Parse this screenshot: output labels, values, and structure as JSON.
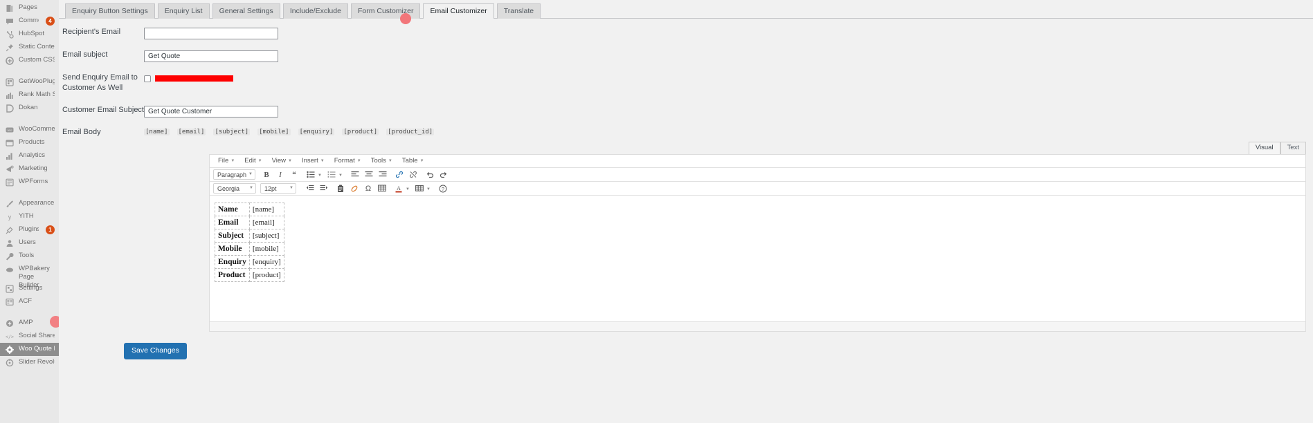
{
  "sidebar": {
    "items": [
      {
        "label": "Pages",
        "icon": "pages-icon",
        "badge": null,
        "active": false,
        "group": 0
      },
      {
        "label": "Comments",
        "icon": "comments-icon",
        "badge": "4",
        "active": false,
        "group": 0
      },
      {
        "label": "HubSpot",
        "icon": "hubspot-icon",
        "badge": null,
        "active": false,
        "group": 0
      },
      {
        "label": "Static Contents",
        "icon": "pin-icon",
        "badge": null,
        "active": false,
        "group": 0
      },
      {
        "label": "Custom CSS & JS",
        "icon": "plus-circle-icon",
        "badge": null,
        "active": false,
        "group": 0
      },
      {
        "label": "GetWooPlugins",
        "icon": "puzzle-icon",
        "badge": null,
        "active": false,
        "group": 1
      },
      {
        "label": "Rank Math SEO",
        "icon": "chart-icon",
        "badge": null,
        "active": false,
        "group": 0
      },
      {
        "label": "Dokan",
        "icon": "dokan-icon",
        "badge": null,
        "active": false,
        "group": 0
      },
      {
        "label": "WooCommerce",
        "icon": "woocommerce-icon",
        "badge": null,
        "active": false,
        "group": 1
      },
      {
        "label": "Products",
        "icon": "products-icon",
        "badge": null,
        "active": false,
        "group": 0
      },
      {
        "label": "Analytics",
        "icon": "analytics-icon",
        "badge": null,
        "active": false,
        "group": 0
      },
      {
        "label": "Marketing",
        "icon": "megaphone-icon",
        "badge": null,
        "active": false,
        "group": 0
      },
      {
        "label": "WPForms",
        "icon": "wpforms-icon",
        "badge": null,
        "active": false,
        "group": 0
      },
      {
        "label": "Appearance",
        "icon": "brush-icon",
        "badge": null,
        "active": false,
        "group": 1
      },
      {
        "label": "YITH",
        "icon": "yith-icon",
        "badge": null,
        "active": false,
        "group": 0
      },
      {
        "label": "Plugins",
        "icon": "plugin-icon",
        "badge": "1",
        "active": false,
        "group": 0
      },
      {
        "label": "Users",
        "icon": "users-icon",
        "badge": null,
        "active": false,
        "group": 0
      },
      {
        "label": "Tools",
        "icon": "tools-icon",
        "badge": null,
        "active": false,
        "group": 0
      },
      {
        "label": "WPBakery Page Builder",
        "icon": "wpbakery-icon",
        "badge": null,
        "active": false,
        "group": 0,
        "tall": true
      },
      {
        "label": "Settings",
        "icon": "settings-icon",
        "badge": null,
        "active": false,
        "group": 0
      },
      {
        "label": "ACF",
        "icon": "acf-icon",
        "badge": null,
        "active": false,
        "group": 0
      },
      {
        "label": "AMP",
        "icon": "amp-icon",
        "badge": null,
        "active": false,
        "group": 1
      },
      {
        "label": "Social Share",
        "icon": "code-icon",
        "badge": null,
        "active": false,
        "group": 0
      },
      {
        "label": "Woo Quote Popup",
        "icon": "gear-icon",
        "badge": null,
        "active": true,
        "group": 0
      },
      {
        "label": "Slider Revolution",
        "icon": "slider-revolution-icon",
        "badge": null,
        "active": false,
        "group": 0
      }
    ]
  },
  "tabs": [
    {
      "label": "Enquiry Button Settings",
      "active": false
    },
    {
      "label": "Enquiry List",
      "active": false
    },
    {
      "label": "General Settings",
      "active": false
    },
    {
      "label": "Include/Exclude",
      "active": false
    },
    {
      "label": "Form Customizer",
      "active": false
    },
    {
      "label": "Email Customizer",
      "active": true
    },
    {
      "label": "Translate",
      "active": false
    }
  ],
  "form": {
    "recipient_email": {
      "label": "Recipient's Email",
      "value": "",
      "placeholder": ""
    },
    "email_subject": {
      "label": "Email subject",
      "value": "Get Quote",
      "placeholder": ""
    },
    "send_to_customer": {
      "label": "Send Enquiry Email to Customer As Well",
      "checked": false,
      "redacted_value": ""
    },
    "customer_email_subject": {
      "label": "Customer Email Subject",
      "value": "Get Quote Customer",
      "placeholder": ""
    },
    "email_body": {
      "label": "Email Body"
    }
  },
  "shortcodes": [
    "[name]",
    "[email]",
    "[subject]",
    "[mobile]",
    "[enquiry]",
    "[product]",
    "[product_id]"
  ],
  "editor": {
    "view_tabs": [
      {
        "label": "Visual",
        "active": true
      },
      {
        "label": "Text",
        "active": false
      }
    ],
    "menus": [
      "File",
      "Edit",
      "View",
      "Insert",
      "Format",
      "Tools",
      "Table"
    ],
    "block_format": "Paragraph",
    "font_family": "Georgia",
    "font_size": "12pt",
    "body_rows": [
      {
        "key": "Name",
        "value": "[name]"
      },
      {
        "key": "Email",
        "value": "[email]"
      },
      {
        "key": "Subject",
        "value": "[subject]"
      },
      {
        "key": "Mobile",
        "value": "[mobile]"
      },
      {
        "key": "Enquiry",
        "value": "[enquiry]"
      },
      {
        "key": "Product",
        "value": "[product]"
      }
    ]
  },
  "actions": {
    "save_label": "Save Changes"
  },
  "colors": {
    "accent": "#2271b1",
    "badge": "#d94f17",
    "redaction": "#fe0000",
    "cursor": "#f2767a",
    "sidebar_active": "#8d8d8d"
  }
}
